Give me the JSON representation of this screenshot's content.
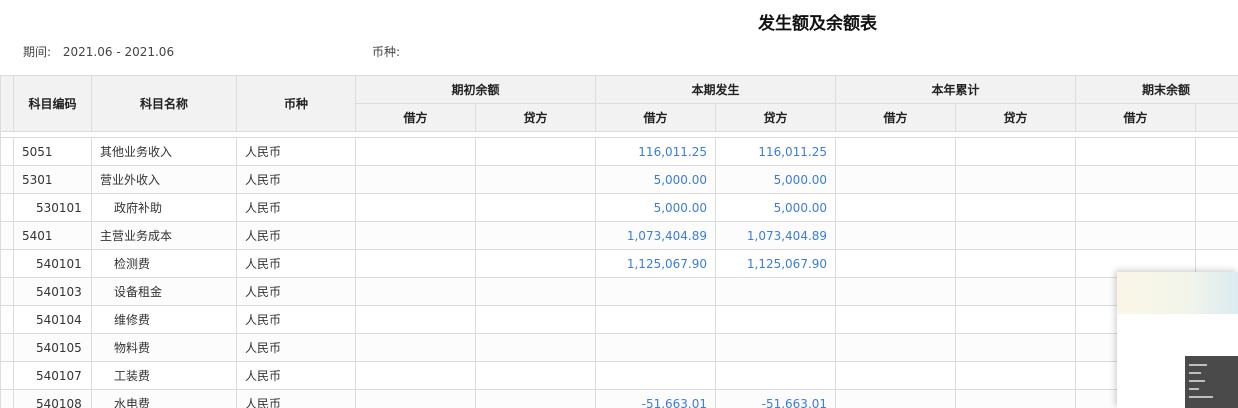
{
  "report": {
    "title": "发生额及余额表",
    "period_label": "期间:",
    "period_value": "2021.06 - 2021.06",
    "currency_label": "币种:",
    "currency_value": ""
  },
  "columns": {
    "code": "科目编码",
    "name": "科目名称",
    "currency": "币种",
    "opening": "期初余额",
    "current": "本期发生",
    "ytd": "本年累计",
    "closing": "期末余额",
    "debit": "借方",
    "credit": "贷方"
  },
  "rows": [
    {
      "code": "5051",
      "name": "其他业务收入",
      "currency": "人民币",
      "opening_debit": "",
      "opening_credit": "",
      "current_debit": "116,011.25",
      "current_credit": "116,011.25",
      "ytd_debit": "",
      "ytd_credit": "",
      "closing_debit": "",
      "level": 1
    },
    {
      "code": "5301",
      "name": "营业外收入",
      "currency": "人民币",
      "opening_debit": "",
      "opening_credit": "",
      "current_debit": "5,000.00",
      "current_credit": "5,000.00",
      "ytd_debit": "",
      "ytd_credit": "",
      "closing_debit": "",
      "level": 1
    },
    {
      "code": "530101",
      "name": "政府补助",
      "currency": "人民币",
      "opening_debit": "",
      "opening_credit": "",
      "current_debit": "5,000.00",
      "current_credit": "5,000.00",
      "ytd_debit": "",
      "ytd_credit": "",
      "closing_debit": "",
      "level": 2
    },
    {
      "code": "5401",
      "name": "主营业务成本",
      "currency": "人民币",
      "opening_debit": "",
      "opening_credit": "",
      "current_debit": "1,073,404.89",
      "current_credit": "1,073,404.89",
      "ytd_debit": "",
      "ytd_credit": "",
      "closing_debit": "",
      "level": 1
    },
    {
      "code": "540101",
      "name": "检测费",
      "currency": "人民币",
      "opening_debit": "",
      "opening_credit": "",
      "current_debit": "1,125,067.90",
      "current_credit": "1,125,067.90",
      "ytd_debit": "",
      "ytd_credit": "",
      "closing_debit": "",
      "level": 2
    },
    {
      "code": "540103",
      "name": "设备租金",
      "currency": "人民币",
      "opening_debit": "",
      "opening_credit": "",
      "current_debit": "",
      "current_credit": "",
      "ytd_debit": "",
      "ytd_credit": "",
      "closing_debit": "",
      "level": 2
    },
    {
      "code": "540104",
      "name": "维修费",
      "currency": "人民币",
      "opening_debit": "",
      "opening_credit": "",
      "current_debit": "",
      "current_credit": "",
      "ytd_debit": "",
      "ytd_credit": "",
      "closing_debit": "",
      "level": 2
    },
    {
      "code": "540105",
      "name": "物料费",
      "currency": "人民币",
      "opening_debit": "",
      "opening_credit": "",
      "current_debit": "",
      "current_credit": "",
      "ytd_debit": "",
      "ytd_credit": "",
      "closing_debit": "",
      "level": 2
    },
    {
      "code": "540107",
      "name": "工装费",
      "currency": "人民币",
      "opening_debit": "",
      "opening_credit": "",
      "current_debit": "",
      "current_credit": "",
      "ytd_debit": "",
      "ytd_credit": "",
      "closing_debit": "",
      "level": 2
    },
    {
      "code": "540108",
      "name": "水电费",
      "currency": "人民币",
      "opening_debit": "",
      "opening_credit": "",
      "current_debit": "-51,663.01",
      "current_credit": "-51,663.01",
      "ytd_debit": "",
      "ytd_credit": "",
      "closing_debit": "",
      "level": 2
    }
  ],
  "colors": {
    "amount_text": "#3b7ddd",
    "header_bg": "#f2f2f2",
    "grid_border": "#dcdcdc"
  }
}
